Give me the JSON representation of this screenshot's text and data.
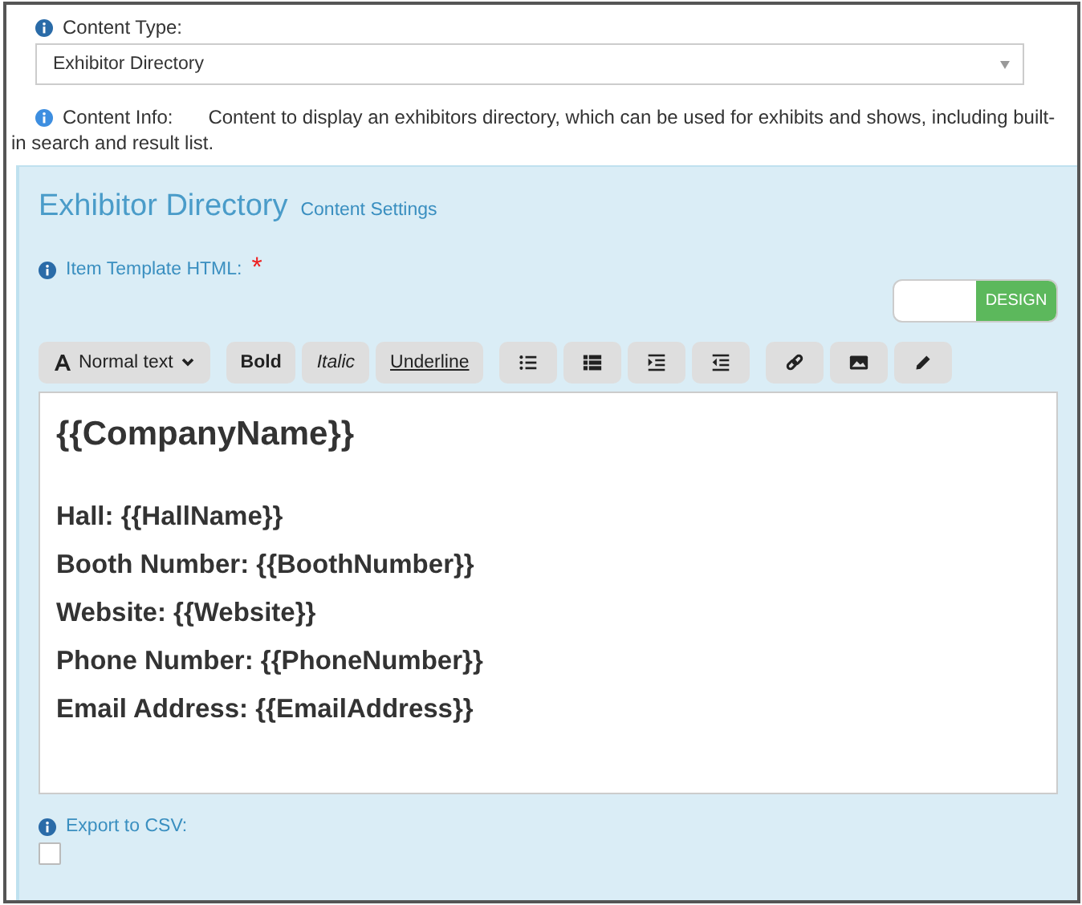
{
  "content_type": {
    "label": "Content Type:",
    "value": "Exhibitor Directory"
  },
  "content_info": {
    "label": "Content Info:",
    "text_lines": [
      "Content to display an exhibitors directory, which can be used for exhibits and shows, including built-",
      "in search and result list."
    ]
  },
  "panel": {
    "title": "Exhibitor Directory",
    "subtitle": "Content Settings"
  },
  "template_field": {
    "label": "Item Template HTML:",
    "required_mark": "*"
  },
  "mode_toggle": {
    "label": "DESIGN"
  },
  "toolbar": [
    {
      "kind": "dropdown",
      "label": "Normal text"
    },
    {
      "kind": "bold",
      "label": "Bold"
    },
    {
      "kind": "italic",
      "label": "Italic"
    },
    {
      "kind": "underline",
      "label": "Underline"
    }
  ],
  "editor": {
    "heading": "{{CompanyName}}",
    "lines": [
      "Hall: {{HallName}}",
      "Booth Number: {{BoothNumber}}",
      "Website: {{Website}}",
      "Phone Number: {{PhoneNumber}}",
      "Email Address: {{EmailAddress}}"
    ]
  },
  "export": {
    "label": "Export to CSV:",
    "checked": false
  }
}
